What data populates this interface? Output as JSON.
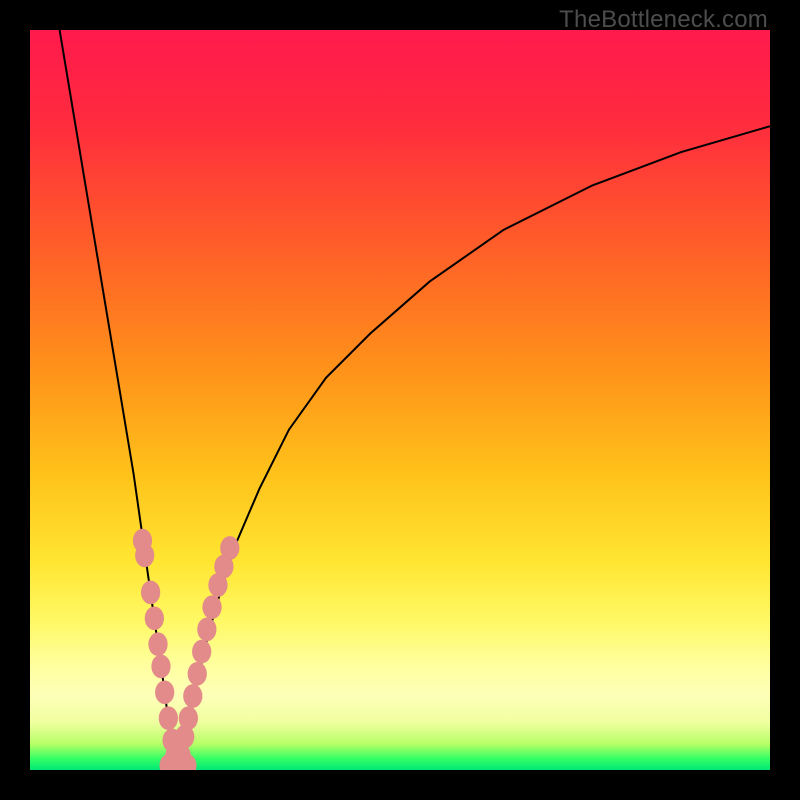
{
  "watermark": "TheBottleneck.com",
  "gradient_stops": [
    {
      "offset": 0.0,
      "color": "#ff1a4d"
    },
    {
      "offset": 0.12,
      "color": "#ff2a3f"
    },
    {
      "offset": 0.28,
      "color": "#ff5a2a"
    },
    {
      "offset": 0.45,
      "color": "#ff8f1a"
    },
    {
      "offset": 0.6,
      "color": "#ffc21a"
    },
    {
      "offset": 0.72,
      "color": "#ffe633"
    },
    {
      "offset": 0.8,
      "color": "#fff966"
    },
    {
      "offset": 0.86,
      "color": "#ffffa0"
    },
    {
      "offset": 0.9,
      "color": "#feffb8"
    },
    {
      "offset": 0.935,
      "color": "#f0ffa0"
    },
    {
      "offset": 0.965,
      "color": "#b6ff66"
    },
    {
      "offset": 0.985,
      "color": "#33ff66"
    },
    {
      "offset": 1.0,
      "color": "#00e676"
    }
  ],
  "chart_data": {
    "type": "line",
    "title": "",
    "xlabel": "",
    "ylabel": "",
    "xlim": [
      0,
      100
    ],
    "ylim": [
      0,
      100
    ],
    "minimum_x": 20,
    "series": [
      {
        "name": "left-branch",
        "x": [
          4,
          6,
          8,
          10,
          12,
          14,
          15,
          16,
          17,
          18,
          18.8,
          19.4,
          20
        ],
        "y": [
          100,
          88,
          76,
          64,
          52,
          40,
          33,
          26,
          19,
          12,
          6,
          2.5,
          0
        ]
      },
      {
        "name": "right-branch",
        "x": [
          20,
          20.6,
          21.4,
          22.4,
          24,
          26,
          28,
          31,
          35,
          40,
          46,
          54,
          64,
          76,
          88,
          100
        ],
        "y": [
          0,
          2.5,
          6,
          11,
          18,
          25,
          31,
          38,
          46,
          53,
          59,
          66,
          73,
          79,
          83.5,
          87
        ]
      },
      {
        "name": "markers-left",
        "type": "scatter",
        "x": [
          15.2,
          15.5,
          16.3,
          16.8,
          17.3,
          17.7,
          18.2,
          18.7,
          19.2,
          19.6
        ],
        "y": [
          31,
          29,
          24,
          20.5,
          17,
          14,
          10.5,
          7,
          4,
          2
        ]
      },
      {
        "name": "markers-right",
        "type": "scatter",
        "x": [
          20.4,
          20.9,
          21.4,
          22.0,
          22.6,
          23.2,
          23.9,
          24.6,
          25.4,
          26.2,
          27.0
        ],
        "y": [
          2,
          4.5,
          7,
          10,
          13,
          16,
          19,
          22,
          25,
          27.5,
          30
        ]
      },
      {
        "name": "markers-bottom",
        "type": "scatter",
        "x": [
          18.8,
          19.4,
          20.0,
          20.6,
          21.2
        ],
        "y": [
          0.6,
          0.3,
          0.2,
          0.3,
          0.6
        ]
      }
    ],
    "marker_color": "#e38a8a",
    "curve_color": "#000000"
  }
}
